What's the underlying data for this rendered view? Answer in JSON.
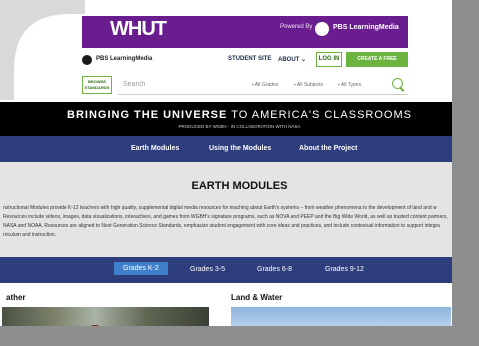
{
  "colors": {
    "banner": "#6a1d8f",
    "nav": "#2e3d7c",
    "accent_green": "#6cb33f",
    "active_grade": "#3f7fcb"
  },
  "banner": {
    "logo": "WHUT",
    "powered_by": "Powered By",
    "pbs_logo_text": "PBS LearningMedia"
  },
  "nav": {
    "brand": "PBS LearningMedia",
    "student_site": "STUDENT SITE",
    "about": "ABOUT",
    "login": "LOG IN",
    "create_account": "CREATE A FREE ACCOUNT"
  },
  "search": {
    "browse_label": "BROWSE STANDARDS",
    "placeholder": "Search",
    "filters": [
      "All Grades",
      "All Subjects",
      "All Types"
    ],
    "icon": "search-icon"
  },
  "hero": {
    "title_bold": "BRINGING THE UNIVERSE",
    "title_rest": "TO AMERICA'S CLASSROOMS",
    "subtitle": "PRODUCED BY WGBH  ·  IN COLLABORATION WITH NASA"
  },
  "main_nav": [
    "Earth Modules",
    "Using the Modules",
    "About the Project"
  ],
  "content": {
    "heading": "EARTH MODULES",
    "lines": [
      "nstructional Modules provide K-12 teachers with high quality, supplemental digital media resources for teaching about Earth's systems – from weather phenomena to the development of land and w",
      "Resources include videos, images, data visualizations, interactives, and games from WGBH's signature programs, such as NOVA and PEEP and the Big Wide World, as well as trusted content partners,",
      "NASA and NOAA. Resources are aligned to Next Generation Science Standards, emphasize student engagement with core ideas and practices, and include contextual information to support integra",
      "rriculum and instruction."
    ]
  },
  "grades": {
    "items": [
      "Grades K-2",
      "Grades 3-5",
      "Grades 6-8",
      "Grades 9-12"
    ],
    "active": "Grades K-2"
  },
  "sections": {
    "left": "ather",
    "right": "Land & Water"
  }
}
